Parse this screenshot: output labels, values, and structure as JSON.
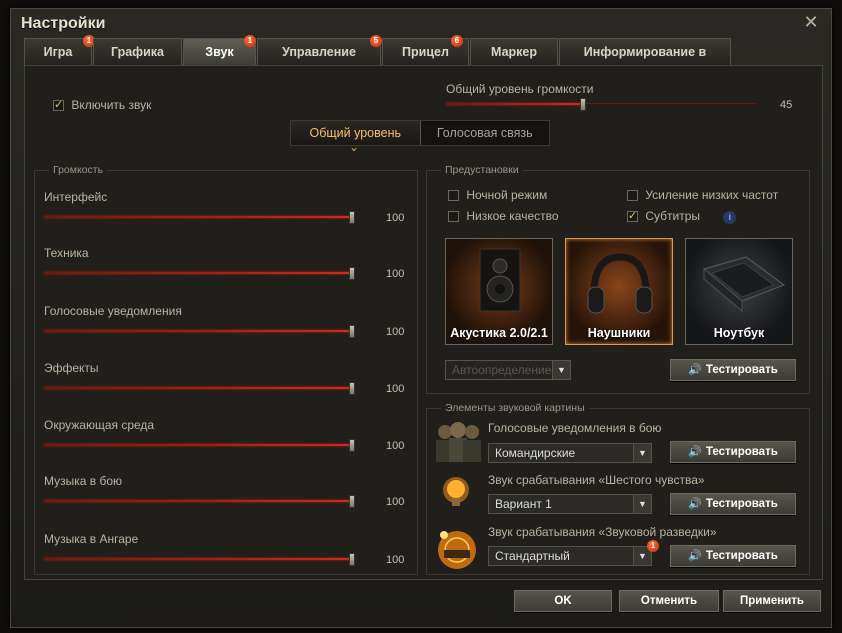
{
  "window": {
    "title": "Настройки",
    "close": "✕"
  },
  "tabs": [
    {
      "label": "Игра",
      "badge": "1"
    },
    {
      "label": "Графика",
      "badge": ""
    },
    {
      "label": "Звук",
      "badge": "1"
    },
    {
      "label": "Управление",
      "badge": "5"
    },
    {
      "label": "Прицел",
      "badge": "6"
    },
    {
      "label": "Маркер",
      "badge": ""
    },
    {
      "label": "Информирование в бою",
      "badge": ""
    }
  ],
  "enable_sound": {
    "label": "Включить звук",
    "checked": true
  },
  "master_volume": {
    "label": "Общий уровень громкости",
    "value": 45
  },
  "subtabs": {
    "general": "Общий уровень",
    "voice": "Голосовая связь"
  },
  "volume_group": {
    "title": "Громкость",
    "items": [
      {
        "label": "Интерфейс",
        "value": 100
      },
      {
        "label": "Техника",
        "value": 100
      },
      {
        "label": "Голосовые уведомления",
        "value": 100
      },
      {
        "label": "Эффекты",
        "value": 100
      },
      {
        "label": "Окружающая среда",
        "value": 100
      },
      {
        "label": "Музыка в бою",
        "value": 100
      },
      {
        "label": "Музыка в Ангаре",
        "value": 100
      }
    ]
  },
  "presets": {
    "title": "Предустановки",
    "night_mode": "Ночной режим",
    "low_quality": "Низкое качество",
    "bass_boost": "Усиление низких частот",
    "subtitles": "Субтитры",
    "info": "i",
    "devices": [
      {
        "label": "Акустика 2.0/2.1",
        "icon": "speaker-icon"
      },
      {
        "label": "Наушники",
        "icon": "headphones-icon"
      },
      {
        "label": "Ноутбук",
        "icon": "laptop-icon"
      }
    ],
    "autodetect": "Автоопределение",
    "test": "Тестировать"
  },
  "elements": {
    "title": "Элементы звуковой картины",
    "voice": {
      "label": "Голосовые уведомления в бою",
      "value": "Командирские",
      "test": "Тестировать"
    },
    "sixth": {
      "label": "Звук срабатывания «Шестого чувства»",
      "value": "Вариант 1",
      "test": "Тестировать"
    },
    "recon": {
      "label": "Звук срабатывания «Звуковой разведки»",
      "value": "Стандартный",
      "badge": "1",
      "test": "Тестировать"
    }
  },
  "buttons": {
    "ok": "OK",
    "cancel": "Отменить",
    "apply": "Применить"
  }
}
